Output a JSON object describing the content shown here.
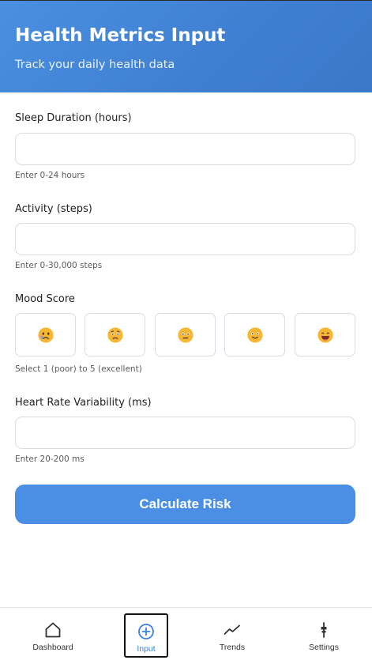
{
  "header": {
    "title": "Health Metrics Input",
    "subtitle": "Track your daily health data"
  },
  "form": {
    "sleep": {
      "label": "Sleep Duration (hours)",
      "value": "",
      "hint": "Enter 0-24 hours"
    },
    "activity": {
      "label": "Activity (steps)",
      "value": "",
      "hint": "Enter 0-30,000 steps"
    },
    "mood": {
      "label": "Mood Score",
      "options": [
        {
          "emoji": "crying-face"
        },
        {
          "emoji": "worried-face"
        },
        {
          "emoji": "neutral-face"
        },
        {
          "emoji": "slightly-smiling-face"
        },
        {
          "emoji": "grinning-face"
        }
      ],
      "hint": "Select 1 (poor) to 5 (excellent)"
    },
    "hrv": {
      "label": "Heart Rate Variability (ms)",
      "value": "",
      "hint": "Enter 20-200 ms"
    },
    "submit_label": "Calculate Risk"
  },
  "nav": {
    "items": [
      {
        "label": "Dashboard",
        "icon": "home-icon"
      },
      {
        "label": "Input",
        "icon": "plus-circle-icon",
        "active": true
      },
      {
        "label": "Trends",
        "icon": "trend-line-icon"
      },
      {
        "label": "Settings",
        "icon": "settings-icon"
      }
    ]
  },
  "colors": {
    "header": "#4a8fe0",
    "accent": "#4a8fe3",
    "active_nav": "#3b82e0"
  }
}
